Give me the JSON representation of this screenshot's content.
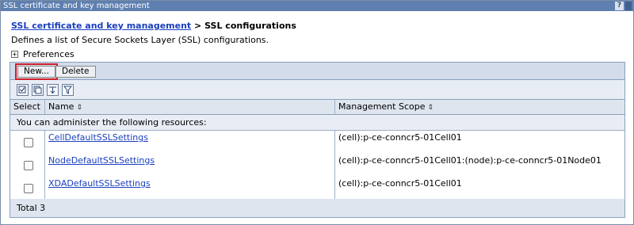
{
  "window": {
    "title": "SSL certificate and key management",
    "help_label": "?"
  },
  "breadcrumb": {
    "link": "SSL certificate and key management",
    "separator": ">",
    "current": "SSL configurations"
  },
  "description": "Defines a list of Secure Sockets Layer (SSL) configurations.",
  "preferences": {
    "toggle": "+",
    "label": "Preferences"
  },
  "toolbar": {
    "new_label": "New...",
    "delete_label": "Delete"
  },
  "icon_toolbar": [
    "select-all-icon",
    "deselect-all-icon",
    "show-filter-icon",
    "clear-filter-icon"
  ],
  "table": {
    "columns": [
      "Select",
      "Name",
      "Management Scope"
    ],
    "sort_glyph": "⇕",
    "info_text": "You can administer the following resources:",
    "rows": [
      {
        "name": "CellDefaultSSLSettings",
        "scope": "(cell):p-ce-conncr5-01Cell01"
      },
      {
        "name": "NodeDefaultSSLSettings",
        "scope": "(cell):p-ce-conncr5-01Cell01:(node):p-ce-conncr5-01Node01"
      },
      {
        "name": "XDADefaultSSLSettings",
        "scope": "(cell):p-ce-conncr5-01Cell01"
      }
    ],
    "total": "Total 3"
  }
}
